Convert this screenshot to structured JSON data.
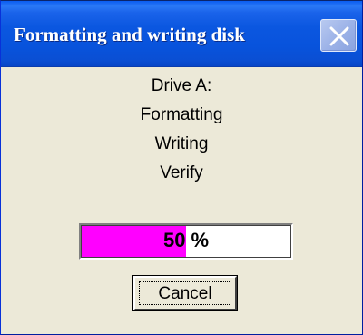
{
  "window": {
    "title": "Formatting and writing disk"
  },
  "titlebar": {
    "close_icon": "close-icon"
  },
  "status": {
    "drive": "Drive A:",
    "step_format": "Formatting",
    "step_write": "Writing",
    "step_verify": "Verify"
  },
  "progress": {
    "value": 50,
    "label_value": "50",
    "label_unit": "%",
    "fill_color": "#ff00ff"
  },
  "buttons": {
    "cancel_label": "Cancel"
  },
  "colors": {
    "titlebar": "#0853dc",
    "window_bg": "#ece9d8"
  }
}
